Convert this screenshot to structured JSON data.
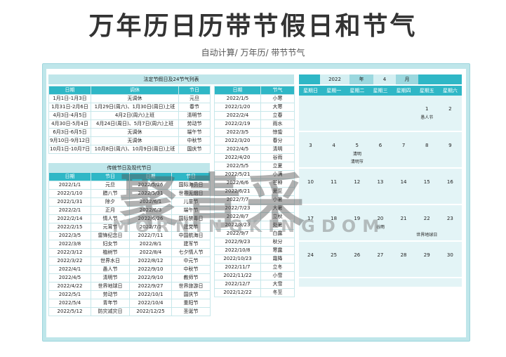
{
  "title": "万年历日历带节假日和节气",
  "subtitle": "自动计算/ 万年历/ 带节节气",
  "holiday": {
    "title": "法定节假日及24节气列表",
    "headers": [
      "日期",
      "调休",
      "节日"
    ],
    "rows": [
      [
        "1月1日-1月3日",
        "无调休",
        "元旦"
      ],
      [
        "1月31日-2月6日",
        "1月29日(周六)、1月30日(周日)上班",
        "春节"
      ],
      [
        "4月3日-4月5日",
        "4月2日(周六)上班",
        "清明节"
      ],
      [
        "4月30日-5月4日",
        "4月24日(周日)、5月7日(周六)上班",
        "劳动节"
      ],
      [
        "6月3日-6月5日",
        "无调休",
        "端午节"
      ],
      [
        "9月10日-9月12日",
        "无调休",
        "中秋节"
      ],
      [
        "10月1日-10月7日",
        "10月8日(周六)、10月9日(周日)上班",
        "国庆节"
      ]
    ]
  },
  "festivals": {
    "title": "传统节日及现代节日",
    "headers": [
      "日期",
      "节日",
      "日期",
      "节日"
    ],
    "rows": [
      [
        "2022/1/1",
        "元旦",
        "2022/5/26",
        "国际海员日"
      ],
      [
        "2022/1/10",
        "腊八节",
        "2022/5/31",
        "世界无烟日"
      ],
      [
        "2022/1/31",
        "除夕",
        "2022/6/1",
        "儿童节"
      ],
      [
        "2022/2/1",
        "正月",
        "2022/6/3",
        "端午节"
      ],
      [
        "2022/2/14",
        "情人节",
        "2022/6/26",
        "国际禁毒日"
      ],
      [
        "2022/2/15",
        "元宵节",
        "2022/7/1",
        "建党节"
      ],
      [
        "2022/3/5",
        "雷锋纪念日",
        "2022/7/11",
        "中国航海日"
      ],
      [
        "2022/3/8",
        "妇女节",
        "2022/8/1",
        "建军节"
      ],
      [
        "2022/3/12",
        "植树节",
        "2022/8/4",
        "七夕情人节"
      ],
      [
        "2022/3/22",
        "世界水日",
        "2022/8/12",
        "中元节"
      ],
      [
        "2022/4/1",
        "愚人节",
        "2022/9/10",
        "中秋节"
      ],
      [
        "2022/4/5",
        "清明节",
        "2022/9/10",
        "教师节"
      ],
      [
        "2022/4/22",
        "世界地球日",
        "2022/9/27",
        "世界旅游日"
      ],
      [
        "2022/5/1",
        "劳动节",
        "2022/10/1",
        "国庆节"
      ],
      [
        "2022/5/4",
        "青年节",
        "2022/10/4",
        "重阳节"
      ],
      [
        "2022/5/12",
        "防灾减灾日",
        "2022/12/25",
        "圣诞节"
      ]
    ]
  },
  "solar_terms": {
    "headers": [
      "日期",
      "节气"
    ],
    "rows": [
      [
        "2022/1/5",
        "小寒"
      ],
      [
        "2022/1/20",
        "大寒"
      ],
      [
        "2022/2/4",
        "立春"
      ],
      [
        "2022/2/19",
        "雨水"
      ],
      [
        "2022/3/5",
        "惊蛰"
      ],
      [
        "2022/3/20",
        "春分"
      ],
      [
        "2022/4/5",
        "清明"
      ],
      [
        "2022/4/20",
        "谷雨"
      ],
      [
        "2022/5/5",
        "立夏"
      ],
      [
        "2022/5/21",
        "小满"
      ],
      [
        "2022/6/6",
        "芒种"
      ],
      [
        "2022/6/21",
        "夏至"
      ],
      [
        "2022/7/7",
        "小暑"
      ],
      [
        "2022/7/23",
        "大暑"
      ],
      [
        "2022/8/7",
        "立秋"
      ],
      [
        "2022/8/23",
        "处暑"
      ],
      [
        "2022/9/7",
        "白露"
      ],
      [
        "2022/9/23",
        "秋分"
      ],
      [
        "2022/10/8",
        "寒露"
      ],
      [
        "2022/10/23",
        "霜降"
      ],
      [
        "2022/11/7",
        "立冬"
      ],
      [
        "2022/11/22",
        "小雪"
      ],
      [
        "2022/12/7",
        "大雪"
      ],
      [
        "2022/12/22",
        "冬至"
      ]
    ]
  },
  "calendar": {
    "year": "2022",
    "year_label": "年",
    "month": "4",
    "month_label": "月",
    "weekdays": [
      "星期日",
      "星期一",
      "星期二",
      "星期三",
      "星期四",
      "星期五",
      "星期六"
    ],
    "weeks": [
      {
        "days": [
          "",
          "",
          "",
          "",
          "",
          "1",
          "2"
        ],
        "notes": [
          {
            "col": 5,
            "row": 0,
            "text": "愚人节"
          }
        ]
      },
      {
        "days": [
          "3",
          "4",
          "5",
          "6",
          "7",
          "8",
          "9"
        ],
        "notes": [
          {
            "col": 2,
            "row": 0,
            "text": "清明"
          },
          {
            "col": 2,
            "row": 1,
            "text": "清明节"
          }
        ]
      },
      {
        "days": [
          "10",
          "11",
          "12",
          "13",
          "14",
          "15",
          "16"
        ],
        "notes": []
      },
      {
        "days": [
          "17",
          "18",
          "19",
          "20",
          "21",
          "22",
          "23"
        ],
        "notes": [
          {
            "col": 3,
            "row": 0,
            "text": "谷雨"
          },
          {
            "col": 5,
            "row": 1,
            "text": "世界地球日"
          }
        ]
      },
      {
        "days": [
          "24",
          "25",
          "26",
          "27",
          "28",
          "29",
          "30"
        ],
        "notes": []
      },
      {
        "days": [],
        "notes": []
      }
    ]
  },
  "watermark": {
    "cn": "聚青采",
    "en": "MORNINGKINGDOM"
  }
}
